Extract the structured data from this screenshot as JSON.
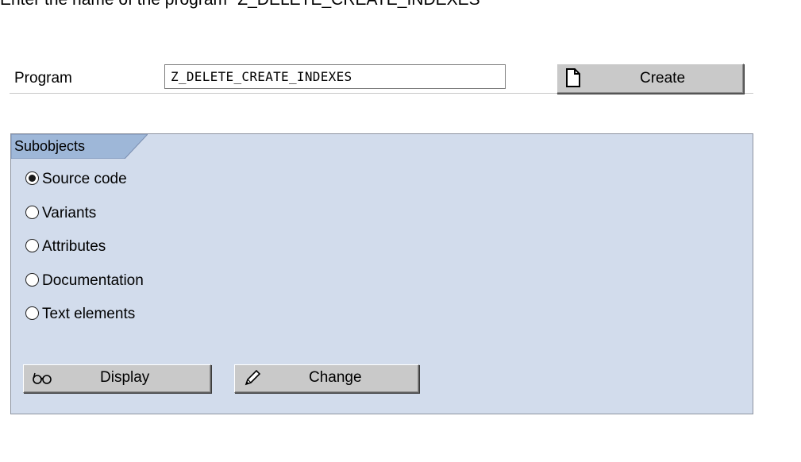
{
  "caption": "Enter the name of the program \"Z_DELETE_CREATE_INDEXES\"",
  "program": {
    "label": "Program",
    "value": "Z_DELETE_CREATE_INDEXES"
  },
  "create_button": {
    "label": "Create",
    "icon": "new-document-icon"
  },
  "subobjects": {
    "title": "Subobjects",
    "options": [
      {
        "label": "Source code",
        "selected": true
      },
      {
        "label": "Variants",
        "selected": false
      },
      {
        "label": "Attributes",
        "selected": false
      },
      {
        "label": "Documentation",
        "selected": false
      },
      {
        "label": "Text elements",
        "selected": false
      }
    ]
  },
  "display_button": {
    "label": "Display",
    "icon": "glasses-icon"
  },
  "change_button": {
    "label": "Change",
    "icon": "pencil-icon"
  },
  "colors": {
    "panel_bg": "#d2dcec",
    "tab_bg": "#9eb7d8",
    "button_bg": "#c9c9c9"
  }
}
